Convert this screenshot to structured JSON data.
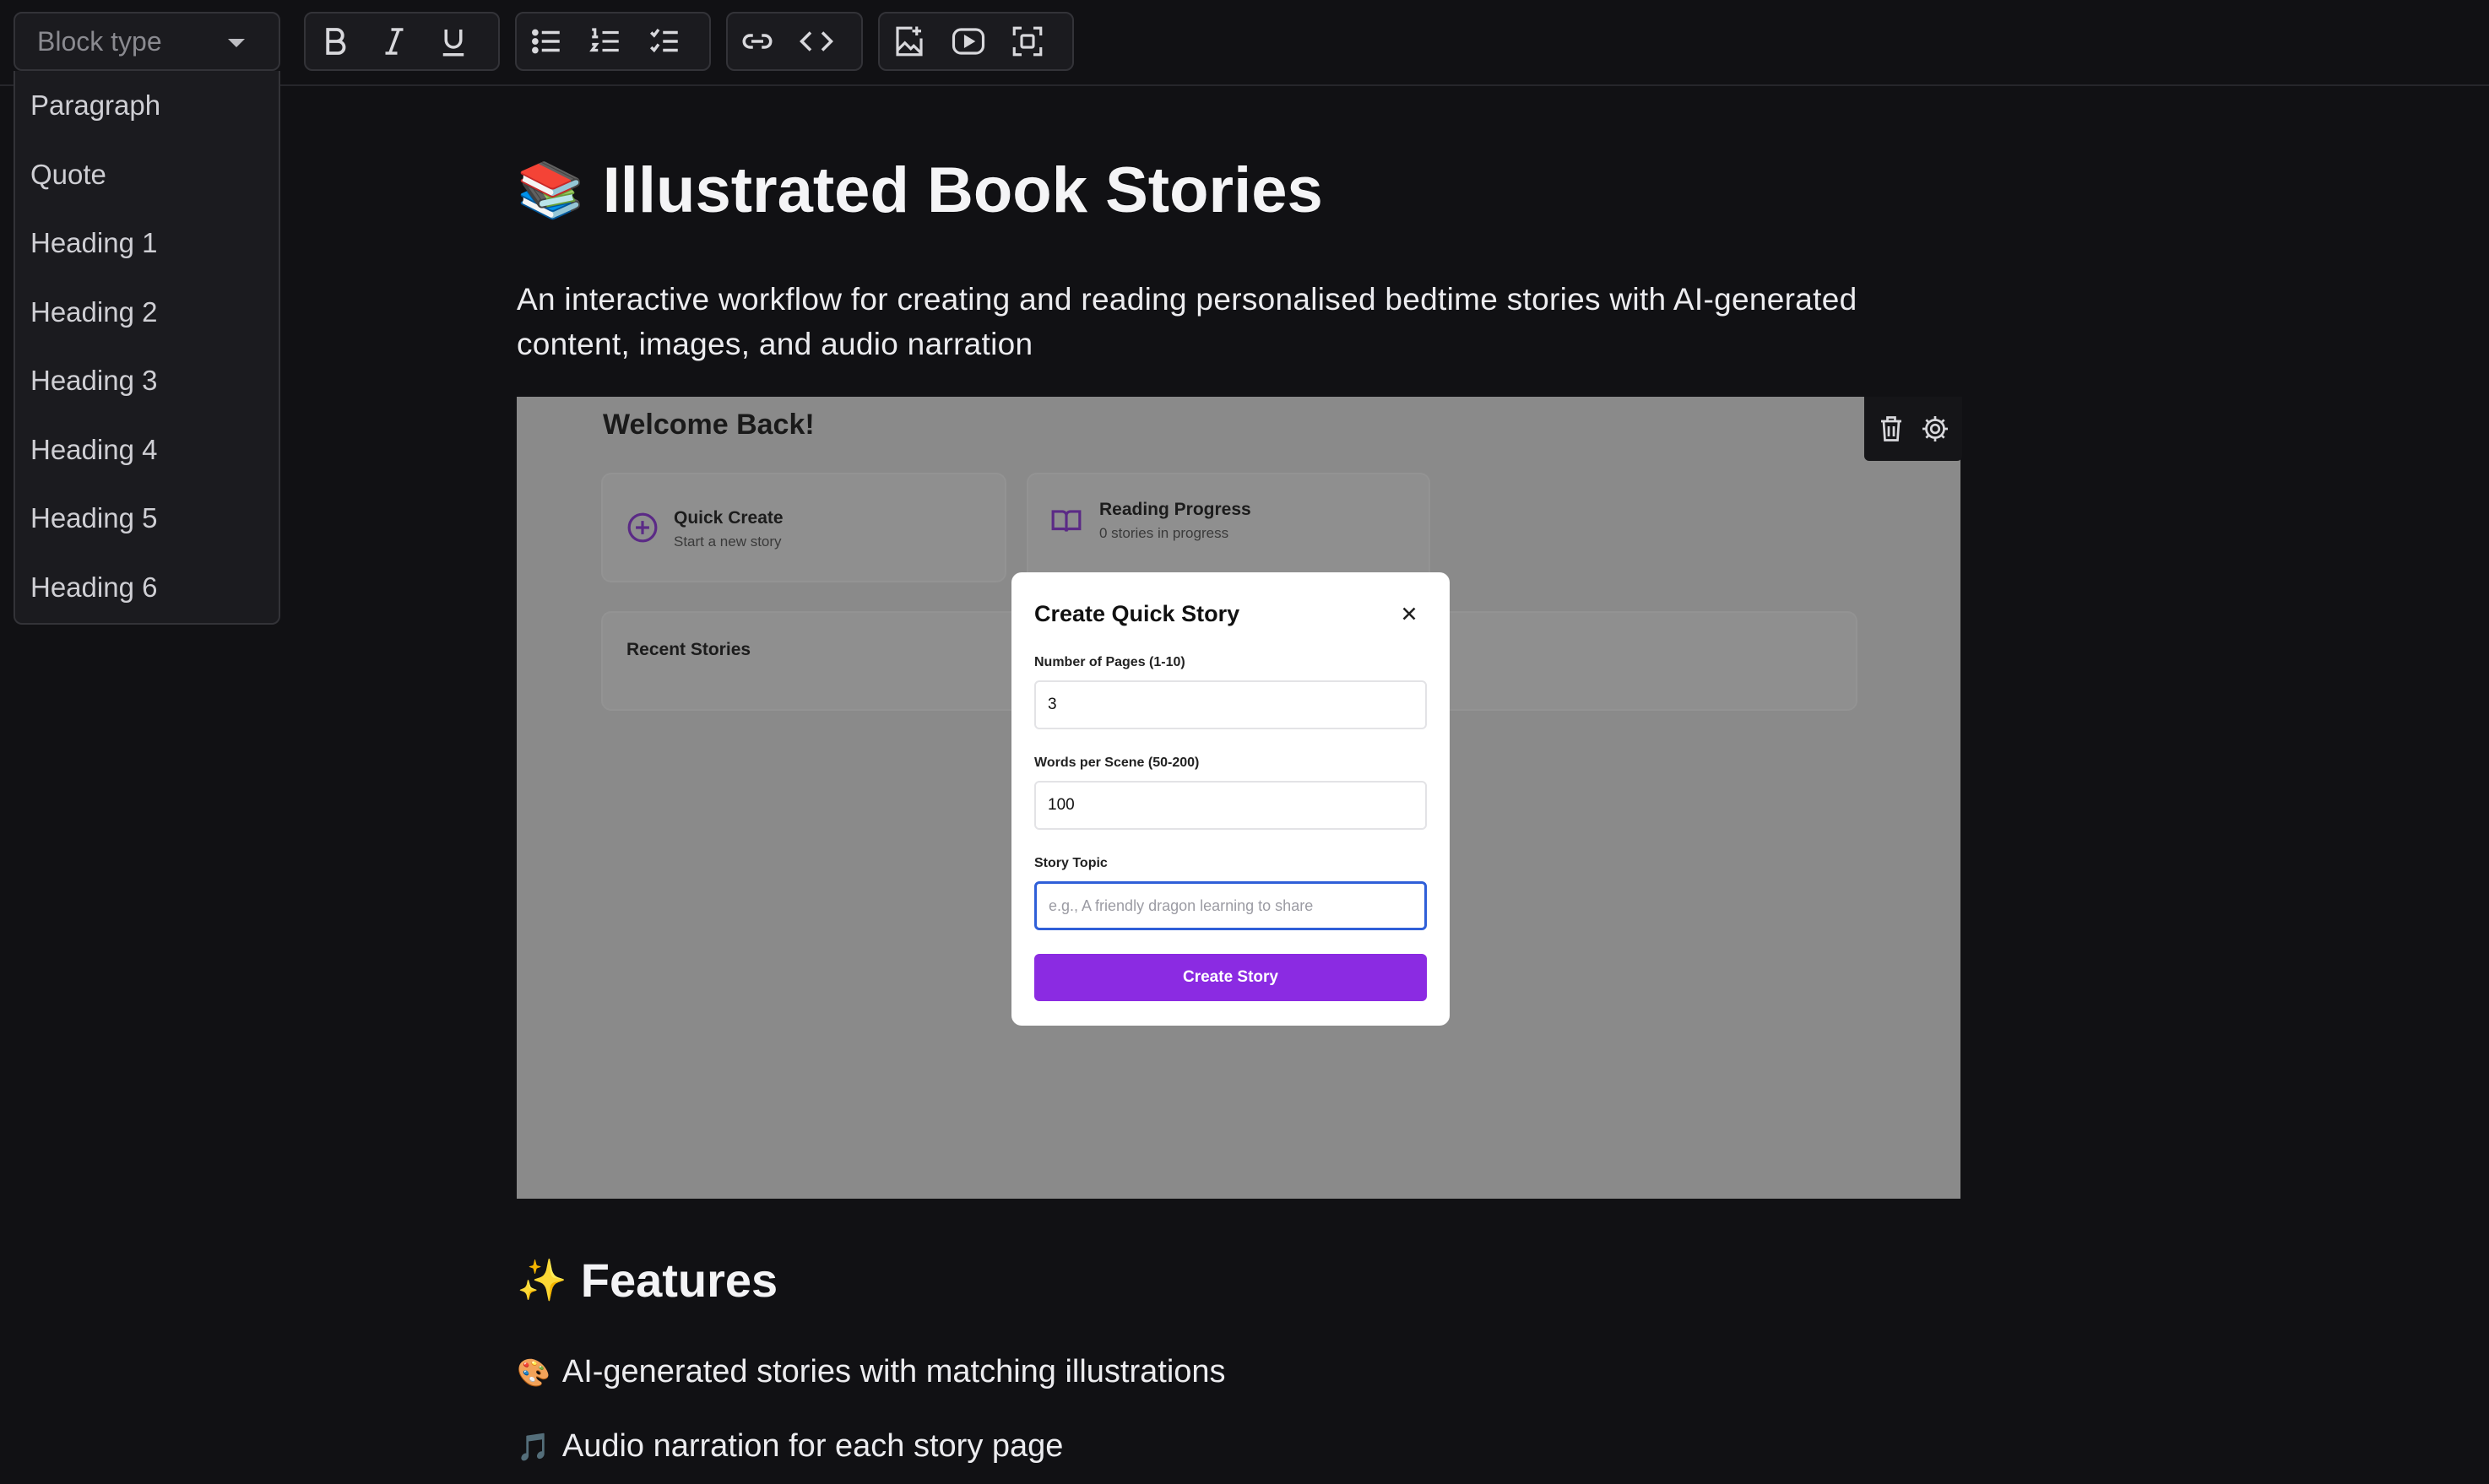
{
  "toolbar": {
    "block_type_placeholder": "Block type"
  },
  "block_menu": {
    "items": [
      "Paragraph",
      "Quote",
      "Heading 1",
      "Heading 2",
      "Heading 3",
      "Heading 4",
      "Heading 5",
      "Heading 6"
    ]
  },
  "document": {
    "title_emoji": "📚",
    "title": "Illustrated Book Stories",
    "intro": "An interactive workflow for creating and reading personalised bedtime stories with AI-generated content, images, and audio narration",
    "features_emoji": "✨",
    "features_heading": "Features",
    "features": [
      {
        "emoji": "🎨",
        "text": "AI-generated stories with matching illustrations"
      },
      {
        "emoji": "🎵",
        "text": "Audio narration for each story page"
      }
    ]
  },
  "embed": {
    "welcome": "Welcome Back!",
    "quick_create": {
      "title": "Quick Create",
      "subtitle": "Start a new story"
    },
    "reading_progress": {
      "title": "Reading Progress",
      "subtitle": "0 stories in progress"
    },
    "recent_stories": "Recent Stories",
    "modal": {
      "title": "Create Quick Story",
      "pages_label": "Number of Pages (1-10)",
      "pages_value": "3",
      "words_label": "Words per Scene (50-200)",
      "words_value": "100",
      "topic_label": "Story Topic",
      "topic_placeholder": "e.g., A friendly dragon learning to share",
      "submit": "Create Story"
    }
  },
  "colors": {
    "background": "#111114",
    "accent": "#8b2be2",
    "focus": "#2f5fd8"
  }
}
